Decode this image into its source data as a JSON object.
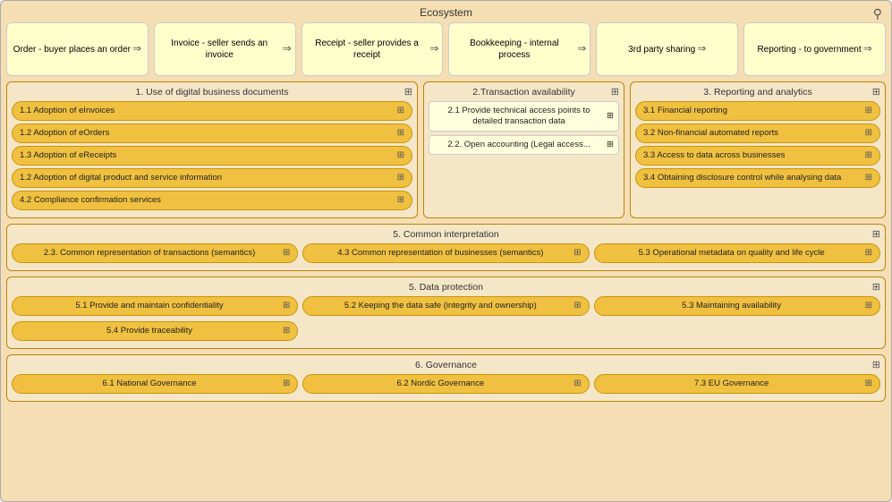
{
  "ecosystem": {
    "title": "Ecosystem",
    "pin": "📍",
    "cards": [
      {
        "text": "Order - buyer places an order",
        "arrow": "⇒"
      },
      {
        "text": "Invoice - seller sends an invoice",
        "arrow": "⇒"
      },
      {
        "text": "Receipt - seller provides a receipt",
        "arrow": "⇒"
      },
      {
        "text": "Bookkeeping - internal process",
        "arrow": "⇒"
      },
      {
        "text": "3rd party sharing",
        "arrow": "⇒"
      },
      {
        "text": "Reporting - to government",
        "arrow": "⇒"
      }
    ]
  },
  "section1": {
    "title": "1. Use of digital business documents",
    "icon": "⊞",
    "items": [
      "1.1 Adoption of eInvoices",
      "1.2 Adoption of eOrders",
      "1.3 Adoption of eReceipts",
      "1.2 Adoption of digital product and service information",
      "4.2 Compliance confirmation services"
    ]
  },
  "section2": {
    "title": "2.Transaction availability",
    "icon": "⊞",
    "items": [
      "2.1 Provide technical access points to detailed transaction data",
      "2.2. Open accounting (Legal access..."
    ]
  },
  "section3": {
    "title": "3. Reporting and analytics",
    "icon": "⊞",
    "items": [
      "3.1 Financial reporting",
      "3.2 Non-financial automated reports",
      "3.3 Access to data across businesses",
      "3.4 Obtaining disclosure control while analysing data"
    ]
  },
  "section5ci": {
    "title": "5. Common interpretation",
    "icon": "⊞",
    "items": [
      {
        "text": "2.3. Common representation of transactions (semantics)",
        "col": 0
      },
      {
        "text": "4.3 Common representation of businesses (semantics)",
        "col": 1
      },
      {
        "text": "5.3 Operational metadata on quality and life cycle",
        "col": 2
      }
    ]
  },
  "section5dp": {
    "title": "5. Data protection",
    "icon": "⊞",
    "rows": [
      [
        "5.1 Provide and maintain confidentiality",
        "5.2 Keeping the data safe (integrity and ownership)",
        "5.3 Maintaining availability"
      ],
      [
        "5.4 Provide traceability"
      ]
    ]
  },
  "section6": {
    "title": "6. Governance",
    "icon": "⊞",
    "items": [
      "6.1 National Governance",
      "6.2 Nordic Governance",
      "7.3 EU Governance"
    ]
  },
  "icons": {
    "grid": "⊞",
    "arrow": "⇒",
    "pin": "⚲"
  }
}
